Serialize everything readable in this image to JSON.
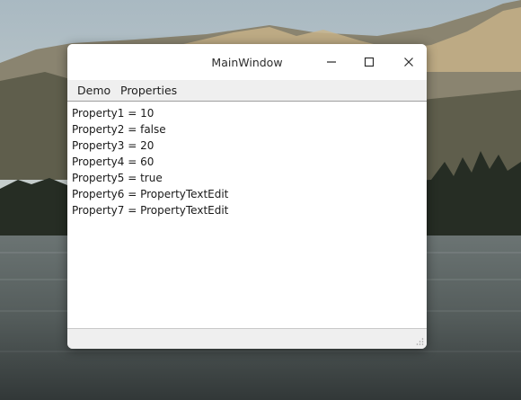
{
  "window": {
    "title": "MainWindow"
  },
  "menubar": {
    "items": [
      {
        "label": "Demo"
      },
      {
        "label": "Properties"
      }
    ]
  },
  "content": {
    "lines": [
      "Property1 = 10",
      "Property2 = false",
      "Property3 = 20",
      "Property4 = 60",
      "Property5 = true",
      "Property6 = PropertyTextEdit",
      "Property7 = PropertyTextEdit"
    ]
  },
  "icons": {
    "minimize": "minimize-icon",
    "maximize": "maximize-icon",
    "close": "close-icon",
    "resize": "resize-grip-icon"
  },
  "colors": {
    "titlebar": "#ffffff",
    "menubar": "#efefef",
    "content": "#ffffff",
    "text": "#1a1a1a"
  }
}
